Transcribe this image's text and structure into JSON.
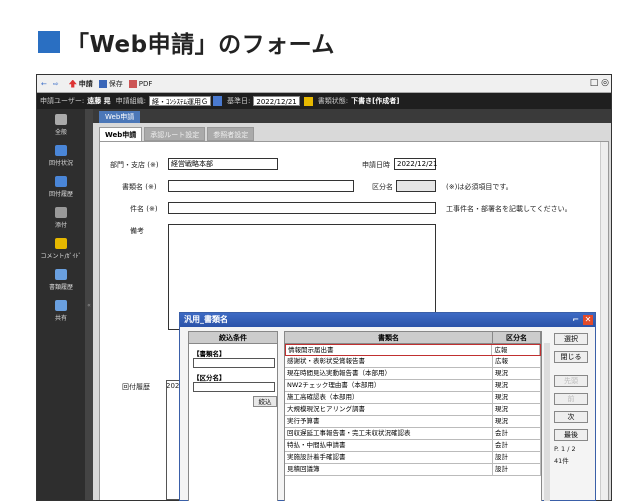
{
  "heading": {
    "title": "「Web申請」のフォーム"
  },
  "colors": {
    "accent": "#2a6fc2",
    "dialog_title": "#2a52a8",
    "selected_border": "#c03030"
  },
  "toolbar": {
    "back": "←",
    "forward": "⇨",
    "items": [
      {
        "label": "申請",
        "icon": "submit-icon"
      },
      {
        "label": "保存",
        "icon": "save-icon"
      },
      {
        "label": "PDF",
        "icon": "pdf-icon"
      }
    ],
    "window_controls": "□ ◎"
  },
  "userbar": {
    "user_label": "申請ユーザー:",
    "user_value": "遠藤 晃",
    "org_label": "申請組織:",
    "org_value": "経・ｺﾝｼｽﾃﾑ運用Ｇ",
    "date_label": "基準日:",
    "date_value": "2022/12/21",
    "status_label": "書類状態:",
    "status_value": "下書き[作成者]"
  },
  "sidebar": {
    "items": [
      {
        "label": "全般",
        "icon": "wrench-icon"
      },
      {
        "label": "回付状況",
        "icon": "document-icon"
      },
      {
        "label": "回付履歴",
        "icon": "history-icon"
      },
      {
        "label": "添付",
        "icon": "paperclip-icon"
      },
      {
        "label": "コメント/ｶﾞｲﾄﾞ",
        "icon": "comment-icon"
      },
      {
        "label": "書類履歴",
        "icon": "book-icon"
      },
      {
        "label": "共有",
        "icon": "share-icon"
      }
    ],
    "collapse": "«"
  },
  "content": {
    "top_tab": "Web申請",
    "form_tabs": [
      "Web申請",
      "承認ルート設定",
      "参照者設定"
    ]
  },
  "form": {
    "dept_label": "部門・支店 (※)",
    "dept_value": "経営戦略本部",
    "date_label": "申請日時",
    "date_value": "2022/12/21",
    "doc_label": "書類名 (※)",
    "doc_value": "",
    "category_label": "区分名",
    "category_value": "",
    "required_note": "(※)は必須項目です。",
    "subject_label": "件名 (※)",
    "subject_value": "",
    "subject_note": "工事件名・部署名を記載してください。",
    "remarks_label": "備考",
    "history_label": "回付履歴",
    "history_value": "2022/"
  },
  "dialog": {
    "title": "汎用_書類名",
    "minimize": "⌐",
    "close": "✕",
    "condition": {
      "header": "絞込条件",
      "doc_label": "【書類名】",
      "category_label": "【区分名】",
      "filter_button": "絞込"
    },
    "grid": {
      "headers": [
        "書類名",
        "区分名"
      ],
      "rows": [
        {
          "name": "情報開示届出書",
          "category": "広報"
        },
        {
          "name": "感謝状・表彰状受賞報告書",
          "category": "広報"
        },
        {
          "name": "現在時間見込実動報告書（本部用）",
          "category": "現況"
        },
        {
          "name": "NW2チェック理由書（本部用）",
          "category": "現況"
        },
        {
          "name": "施工高確認表（本部用）",
          "category": "現況"
        },
        {
          "name": "大規模現況ヒアリング調書",
          "category": "現況"
        },
        {
          "name": "実行予算書",
          "category": "現況"
        },
        {
          "name": "回収遅延工事報告書・完工未収状況確認表",
          "category": "会計"
        },
        {
          "name": "特払・中間払申請書",
          "category": "会計"
        },
        {
          "name": "実施設計着手確認書",
          "category": "設計"
        },
        {
          "name": "見積回議簿",
          "category": "設計"
        }
      ]
    },
    "buttons": {
      "select": "選択",
      "close": "閉じる",
      "first": "先頭",
      "prev": "前",
      "next": "次",
      "last": "最後"
    },
    "page_info": "P. 1 / 2",
    "count_info": "41件"
  }
}
